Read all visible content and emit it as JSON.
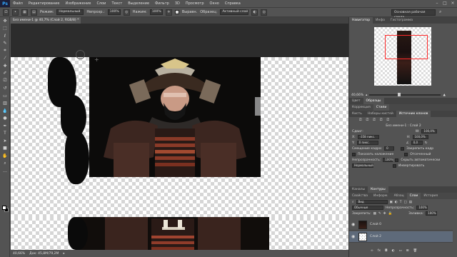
{
  "app": {
    "logo": "Ps",
    "menu": [
      "Файл",
      "Редактирование",
      "Изображение",
      "Слои",
      "Текст",
      "Выделение",
      "Фильтр",
      "3D",
      "Просмотр",
      "Окно",
      "Справка"
    ],
    "window_controls": [
      "–",
      "□",
      "×"
    ]
  },
  "options": {
    "mode_label": "Режим:",
    "mode_value": "Нормальный",
    "opacity_label": "Непрозр.:",
    "opacity_value": "100%",
    "pressure_label": "Нажим:",
    "pressure_value": "100%",
    "align_label": "Выравн.",
    "sample_label": "Образец:",
    "sample_value": "Активный слой",
    "workspace": "Основная рабочая среда"
  },
  "document": {
    "tab_title": "Без имени-1 @ 40,7% (Слой 2, RGB/8) *"
  },
  "status": {
    "zoom": "40,66%",
    "doc_info": "Док: 45,8М/79,2М"
  },
  "navigator": {
    "tabs": [
      "Навигатор",
      "Инфо",
      "Гистограмма"
    ],
    "zoom": "40,66%"
  },
  "color_panel": {
    "tabs": [
      "Цвет",
      "Образцы"
    ],
    "sub_tabs": [
      "Коррекция",
      "Стили"
    ]
  },
  "clone_panel": {
    "tabs": [
      "Кисть",
      "Наборы кистей",
      "Источник клонов"
    ],
    "source_label": "Без имени-1 : Слой 2",
    "offset_label": "Сдвиг:",
    "x_value": "-358 пикс.",
    "y_value": "0 пикс.",
    "w_value": "100,0%",
    "h_value": "100,0%",
    "angle_value": "0,0",
    "frame_offset_label": "Смещение кадра:",
    "frame_offset_value": "0",
    "lock_frame_label": "Закрепить кадр",
    "show_overlay_label": "Показать наложение",
    "clipped_label": "Отсеченный",
    "opacity_label": "Непрозрачность:",
    "opacity_value": "100%",
    "autohide_label": "Скрыть автоматически",
    "blend_value": "Нормальный",
    "invert_label": "Инвертировать"
  },
  "layers_panel": {
    "top_tabs": [
      "Каналы",
      "Контуры"
    ],
    "tabs": [
      "Свойства",
      "Информ.",
      "Абзац",
      "Слои",
      "История"
    ],
    "kind_label": "Вид",
    "blend_value": "Обычные",
    "opacity_label": "Непрозрачность:",
    "opacity_value": "100%",
    "lock_label": "Закрепить:",
    "fill_label": "Заливка:",
    "fill_value": "100%",
    "layers": [
      {
        "name": "Слой 0"
      },
      {
        "name": "Слой 2"
      }
    ]
  },
  "tools": [
    "move-tool-icon",
    "marquee-tool-icon",
    "lasso-tool-icon",
    "quick-select-tool-icon",
    "crop-tool-icon",
    "eyedropper-tool-icon",
    "healing-tool-icon",
    "brush-tool-icon",
    "clone-stamp-tool-icon",
    "history-brush-tool-icon",
    "eraser-tool-icon",
    "gradient-tool-icon",
    "blur-tool-icon",
    "dodge-tool-icon",
    "pen-tool-icon",
    "type-tool-icon",
    "path-select-tool-icon",
    "shape-tool-icon",
    "hand-tool-icon",
    "zoom-tool-icon",
    "more-tools-icon"
  ]
}
